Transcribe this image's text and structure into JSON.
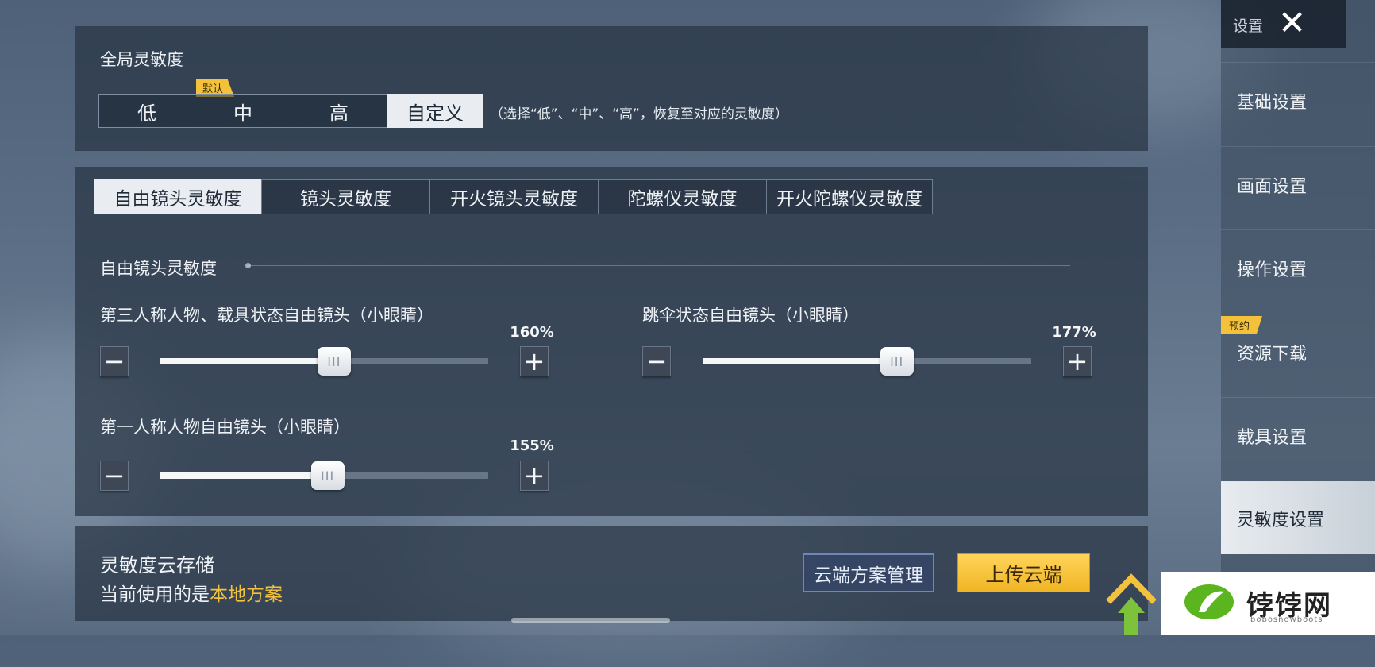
{
  "global": {
    "title": "全局灵敏度",
    "badge": "默认",
    "options": [
      "低",
      "中",
      "高",
      "自定义"
    ],
    "selected": "自定义",
    "hint": "（选择“低”、“中”、“高”，恢复至对应的灵敏度）"
  },
  "tabs": [
    {
      "label": "自由镜头灵敏度",
      "active": true
    },
    {
      "label": "镜头灵敏度",
      "active": false
    },
    {
      "label": "开火镜头灵敏度",
      "active": false
    },
    {
      "label": "陀螺仪灵敏度",
      "active": false
    },
    {
      "label": "开火陀螺仪灵敏度",
      "active": false
    }
  ],
  "section": {
    "title": "自由镜头灵敏度",
    "sliders": [
      {
        "label": "第三人称人物、载具状态自由镜头（小眼睛）",
        "value_text": "160%",
        "fill": 0.53
      },
      {
        "label": "跳伞状态自由镜头（小眼睛）",
        "value_text": "177%",
        "fill": 0.59
      },
      {
        "label": "第一人称人物自由镜头（小眼睛）",
        "value_text": "155%",
        "fill": 0.51
      }
    ],
    "minus_symbol": "−",
    "plus_symbol": "+",
    "thumb_grip": "III"
  },
  "cloud": {
    "title": "灵敏度云存储",
    "status_prefix": "当前使用的是",
    "status_value": "本地方案",
    "manage_button": "云端方案管理",
    "upload_button": "上传云端"
  },
  "sidebar": {
    "header": "设置",
    "close_symbol": "✕",
    "items": [
      "基础设置",
      "画面设置",
      "操作设置",
      "资源下载",
      "载具设置",
      "灵敏度设置"
    ],
    "active": "灵敏度设置",
    "download_badge": "预约"
  },
  "watermark": {
    "text": "饽饽网",
    "url": "bobosnowboots"
  },
  "colors": {
    "accent_yellow": "#f3c23a",
    "active_bg": "#e9edf2",
    "manage_border": "#6f86b6"
  }
}
